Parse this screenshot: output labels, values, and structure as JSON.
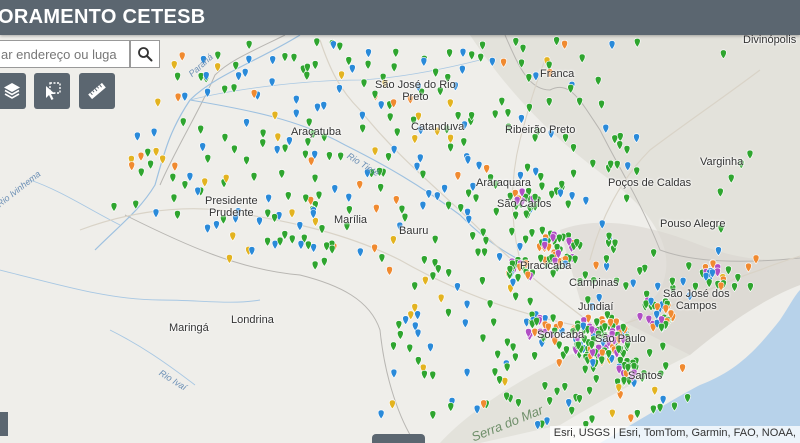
{
  "header": {
    "title": "ORAMENTO CETESB"
  },
  "search": {
    "placeholder": "ar endereço ou luga"
  },
  "toolbar": [
    {
      "name": "layers-button",
      "icon": "layers-icon"
    },
    {
      "name": "select-button",
      "icon": "select-tool-icon"
    },
    {
      "name": "measure-button",
      "icon": "ruler-icon"
    }
  ],
  "map": {
    "cities": [
      {
        "id": "divinopolis",
        "name": "Divinópolis"
      },
      {
        "id": "franca",
        "name": "Franca"
      },
      {
        "id": "sjriopreto",
        "name": "São José do Rio\nPreto"
      },
      {
        "id": "catanduva",
        "name": "Catanduva"
      },
      {
        "id": "ribeiraopreto",
        "name": "Ribeirão Preto"
      },
      {
        "id": "aracatuba",
        "name": "Araçatuba"
      },
      {
        "id": "varginha",
        "name": "Varginha"
      },
      {
        "id": "pocosdecaldas",
        "name": "Poços de Caldas"
      },
      {
        "id": "araraquara",
        "name": "Araraquara"
      },
      {
        "id": "presidenteprudente",
        "name": "Presidente\nPrudente"
      },
      {
        "id": "saocarlos",
        "name": "São Carlos"
      },
      {
        "id": "pousoalegre",
        "name": "Pouso Alegre"
      },
      {
        "id": "marilia",
        "name": "Marília"
      },
      {
        "id": "bauru",
        "name": "Bauru"
      },
      {
        "id": "piracicaba",
        "name": "Piracicaba"
      },
      {
        "id": "campinas",
        "name": "Campinas"
      },
      {
        "id": "sjcampos",
        "name": "São José dos\nCampos"
      },
      {
        "id": "jundiai",
        "name": "Jundiaí"
      },
      {
        "id": "maringa",
        "name": "Maringá"
      },
      {
        "id": "londrina",
        "name": "Londrina"
      },
      {
        "id": "sorocaba",
        "name": "Sorocaba"
      },
      {
        "id": "saopaulo",
        "name": "São Paulo"
      },
      {
        "id": "santos",
        "name": "Santos"
      }
    ],
    "rivers": [
      {
        "id": "parana",
        "name": "Paraná"
      },
      {
        "id": "tiete",
        "name": "Rio Tietê"
      },
      {
        "id": "ivinhema",
        "name": "Rio Ivinhema"
      },
      {
        "id": "ivai",
        "name": "Rio Ivaí"
      },
      {
        "id": "serradomar",
        "name": "Serra do Mar"
      }
    ],
    "legend_colors": {
      "green": "#2fa52f",
      "blue": "#2a8ad9",
      "yellow": "#e3b320",
      "orange": "#f08a30",
      "purple": "#b04fc4"
    }
  },
  "attribution": "Esri, USGS | Esri, TomTom, Garmin, FAO, NOAA,"
}
